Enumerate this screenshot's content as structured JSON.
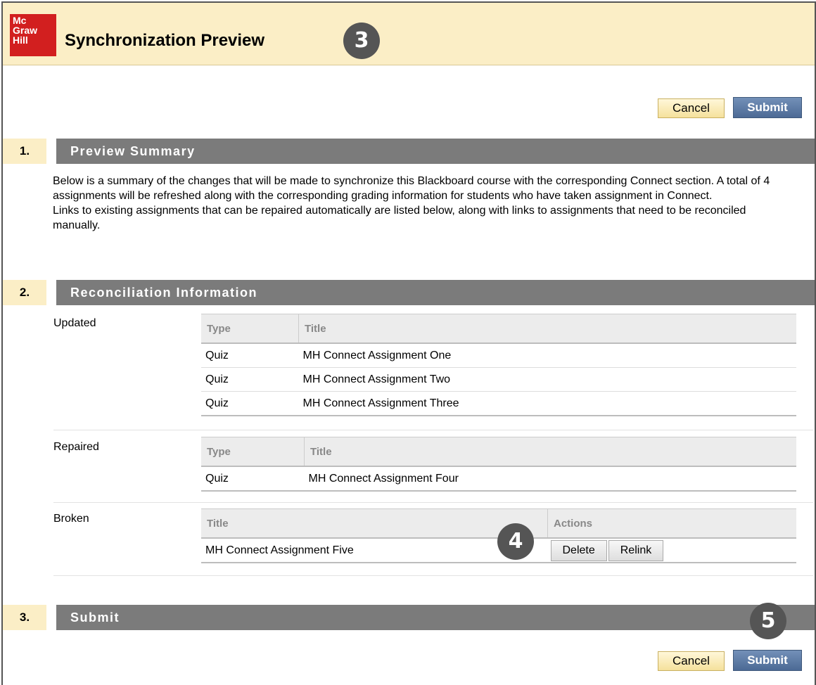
{
  "header": {
    "logo_lines": [
      "Mc",
      "Graw",
      "Hill"
    ],
    "title": "Synchronization Preview",
    "callout": "3"
  },
  "top_actions": {
    "cancel_label": "Cancel",
    "submit_label": "Submit"
  },
  "sections": [
    {
      "num": "1.",
      "title": "Preview Summary"
    },
    {
      "num": "2.",
      "title": "Reconciliation Information"
    },
    {
      "num": "3.",
      "title": "Submit"
    }
  ],
  "summary": {
    "paragraph1": "Below is a summary of the changes that will be made to synchronize this Blackboard course with the corresponding Connect section. A total of 4 assignments will be refreshed along with the corresponding grading information for students who have taken assignment in Connect.",
    "paragraph2": "Links to existing assignments that can be repaired automatically are listed below, along with links to assignments that need to be reconciled manually."
  },
  "updated": {
    "label": "Updated",
    "columns": [
      "Type",
      "Title"
    ],
    "rows": [
      [
        "Quiz",
        "MH Connect Assignment One"
      ],
      [
        "Quiz",
        "MH Connect Assignment Two"
      ],
      [
        "Quiz",
        "MH Connect Assignment Three"
      ]
    ]
  },
  "repaired": {
    "label": "Repaired",
    "columns": [
      "Type",
      "Title"
    ],
    "rows": [
      [
        "Quiz",
        "MH Connect Assignment Four"
      ]
    ]
  },
  "broken": {
    "label": "Broken",
    "columns": [
      "Title",
      "Actions"
    ],
    "rows": [
      {
        "title": "MH Connect Assignment Five",
        "delete_label": "Delete",
        "relink_label": "Relink"
      }
    ]
  },
  "callouts": {
    "four": "4",
    "five": "5"
  },
  "bottom_actions": {
    "cancel_label": "Cancel",
    "submit_label": "Submit"
  }
}
